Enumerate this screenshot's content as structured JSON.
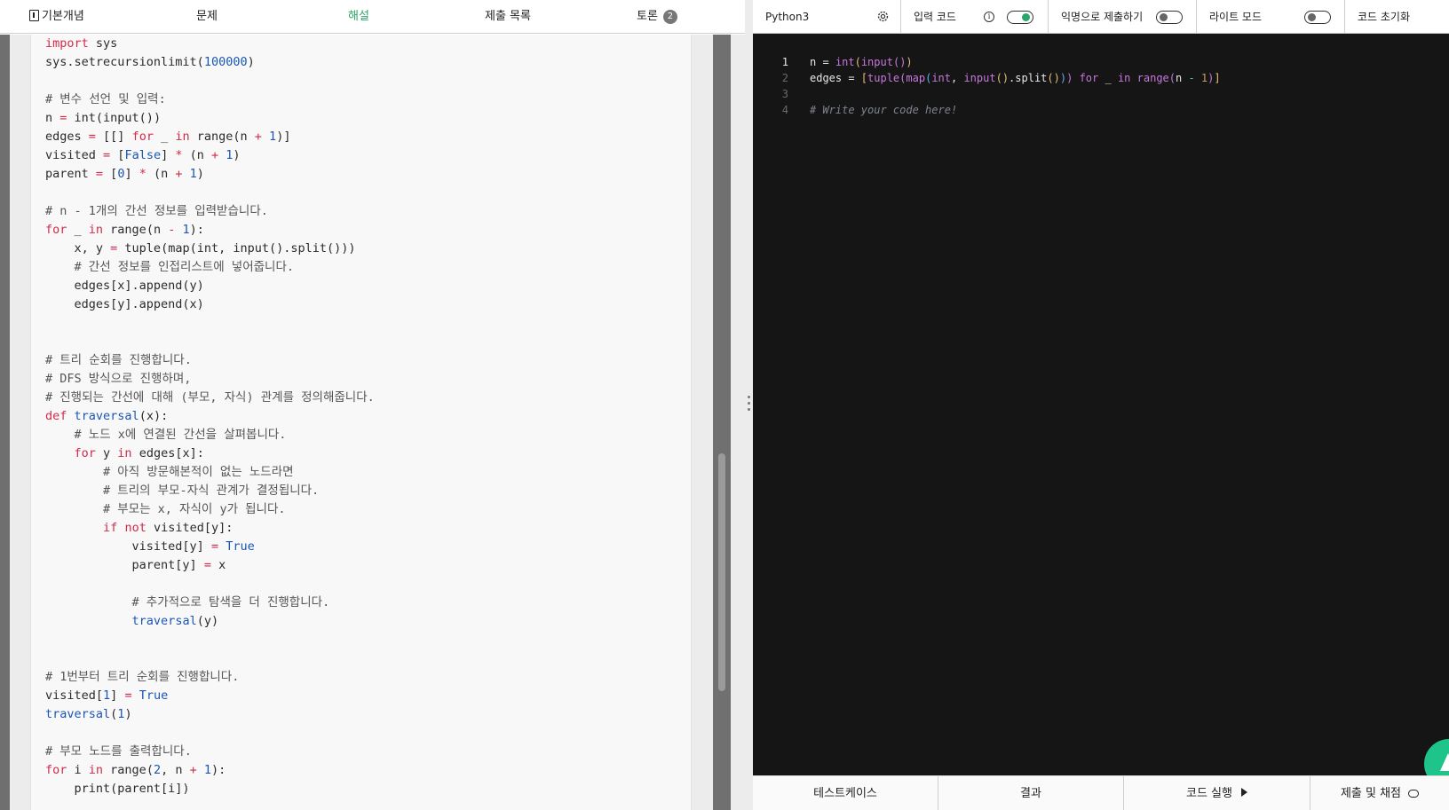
{
  "left": {
    "tabs": [
      {
        "label": "기본개념",
        "icon": "book-icon"
      },
      {
        "label": "문제"
      },
      {
        "label": "해설",
        "active": true
      },
      {
        "label": "제출 목록"
      },
      {
        "label": "토론",
        "badge": "2"
      }
    ],
    "colors": {
      "active_tab": "#2aa56b"
    },
    "code_lines": [
      "import sys",
      "sys.setrecursionlimit(100000)",
      "",
      "# 변수 선언 및 입력:",
      "n = int(input())",
      "edges = [[] for _ in range(n + 1)]",
      "visited = [False] * (n + 1)",
      "parent = [0] * (n + 1)",
      "",
      "# n - 1개의 간선 정보를 입력받습니다.",
      "for _ in range(n - 1):",
      "    x, y = tuple(map(int, input().split()))",
      "    # 간선 정보를 인접리스트에 넣어줍니다.",
      "    edges[x].append(y)",
      "    edges[y].append(x)",
      "",
      "",
      "# 트리 순회를 진행합니다.",
      "# DFS 방식으로 진행하며,",
      "# 진행되는 간선에 대해 (부모, 자식) 관계를 정의해줍니다.",
      "def traversal(x):",
      "    # 노드 x에 연결된 간선을 살펴봅니다.",
      "    for y in edges[x]:",
      "        # 아직 방문해본적이 없는 노드라면",
      "        # 트리의 부모-자식 관계가 결정됩니다.",
      "        # 부모는 x, 자식이 y가 됩니다.",
      "        if not visited[y]:",
      "            visited[y] = True",
      "            parent[y] = x",
      "",
      "            # 추가적으로 탐색을 더 진행합니다.",
      "            traversal(y)",
      "",
      "",
      "# 1번부터 트리 순회를 진행합니다.",
      "visited[1] = True",
      "traversal(1)",
      "",
      "# 부모 노드를 출력합니다.",
      "for i in range(2, n + 1):",
      "    print(parent[i])"
    ]
  },
  "right": {
    "toolbar": {
      "language": "Python3",
      "language_icon": "gear-icon",
      "input_code_label": "입력 코드",
      "input_code_on": true,
      "anonymous_label": "익명으로 제출하기",
      "anonymous_on": false,
      "light_mode_label": "라이트 모드",
      "light_mode_on": false,
      "reset_label": "코드 초기화"
    },
    "editor": {
      "line_numbers": [
        "1",
        "2",
        "3",
        "4"
      ],
      "current_line": "1",
      "lines": [
        "n = int(input())",
        "edges = [tuple(map(int, input().split())) for _ in range(n - 1)]",
        "",
        "# Write your code here!"
      ]
    },
    "bottom": {
      "testcase_label": "테스트케이스",
      "result_label": "결과",
      "run_label": "코드 실행",
      "submit_label": "제출 및 채점"
    },
    "colors": {
      "editor_bg": "#151515",
      "fab": "#1ec48a",
      "toggle_on": "#2aa56b"
    }
  }
}
